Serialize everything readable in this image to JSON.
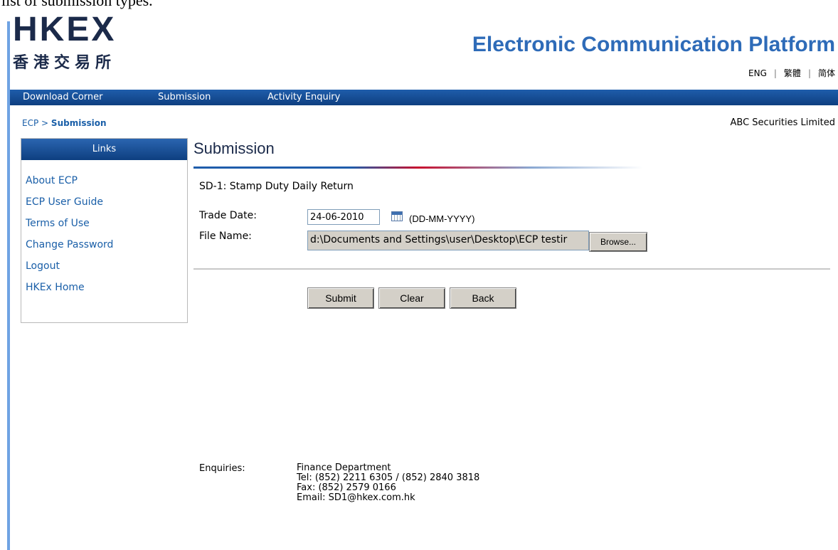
{
  "caption": "list of submission types.",
  "header": {
    "logo_en": "HKEX",
    "logo_zh": "香港交易所",
    "app_title": "Electronic Communication Platform",
    "languages": [
      "ENG",
      "繁體",
      "简体"
    ]
  },
  "nav": {
    "items": [
      "Download Corner",
      "Submission",
      "Activity Enquiry"
    ]
  },
  "breadcrumb": {
    "root": "ECP",
    "separator": ">",
    "current": "Submission"
  },
  "company": "ABC Securities Limited",
  "sidebar": {
    "title": "Links",
    "items": [
      "About ECP",
      "ECP User Guide",
      "Terms of Use",
      "Change Password",
      "Logout",
      "HKEx Home"
    ]
  },
  "main": {
    "title": "Submission",
    "form_type": "SD-1: Stamp Duty Daily Return",
    "trade_date_label": "Trade Date:",
    "trade_date_value": "24-06-2010",
    "date_format": "(DD-MM-YYYY)",
    "file_name_label": "File Name:",
    "file_name_value": "d:\\Documents and Settings\\user\\Desktop\\ECP testir",
    "browse_label": "Browse...",
    "buttons": {
      "submit": "Submit",
      "clear": "Clear",
      "back": "Back"
    }
  },
  "enquiries": {
    "label": "Enquiries:",
    "department": "Finance Department",
    "tel": "Tel: (852) 2211 6305 / (852) 2840 3818",
    "fax": "Fax: (852) 2579 0166",
    "email": "Email: SD1@hkex.com.hk"
  },
  "colors": {
    "brand_navy": "#1b2a4a",
    "title_blue": "#2e6bb8",
    "nav_blue": "#1f5dab",
    "link_blue": "#1a5fa8",
    "button_gray": "#d4d0c8"
  }
}
